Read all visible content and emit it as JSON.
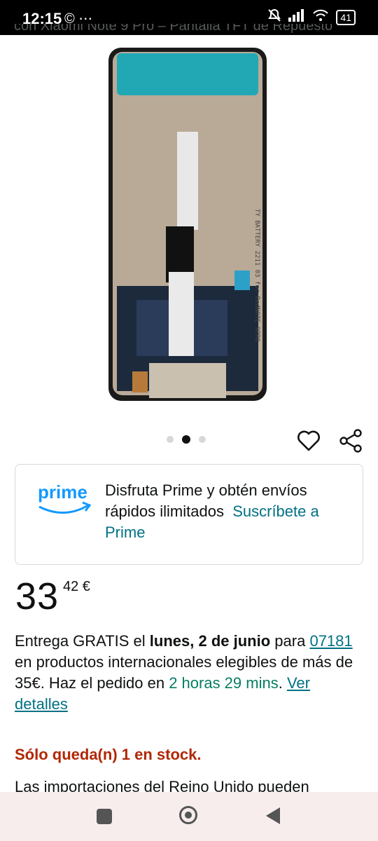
{
  "status_bar": {
    "time": "12:15",
    "left_icons": "© ⋯",
    "battery": "41"
  },
  "top_title_partial": "con Xiaomi Note 9 Pro – Pantalla TFT de Repuesto",
  "gallery": {
    "dots": 3,
    "active_dot": 1
  },
  "prime_banner": {
    "logo_text": "prime",
    "text": "Disfruta Prime y obtén envíos rápidos ilimitados",
    "link": "Suscríbete a Prime"
  },
  "price": {
    "whole": "33",
    "fraction": "42 €"
  },
  "delivery": {
    "prefix": "Entrega GRATIS el",
    "date": "lunes, 2 de junio",
    "mid": "para",
    "postcode": "07181",
    "condition": "en productos internacionales elegibles de más de 35€. Haz el pedido en",
    "countdown": "2 horas 29 mins",
    "dot": ".",
    "details_link": "Ver detalles"
  },
  "stock_text": "Sólo queda(n) 1 en stock.",
  "import_note": "Las importaciones del Reino Unido pueden"
}
